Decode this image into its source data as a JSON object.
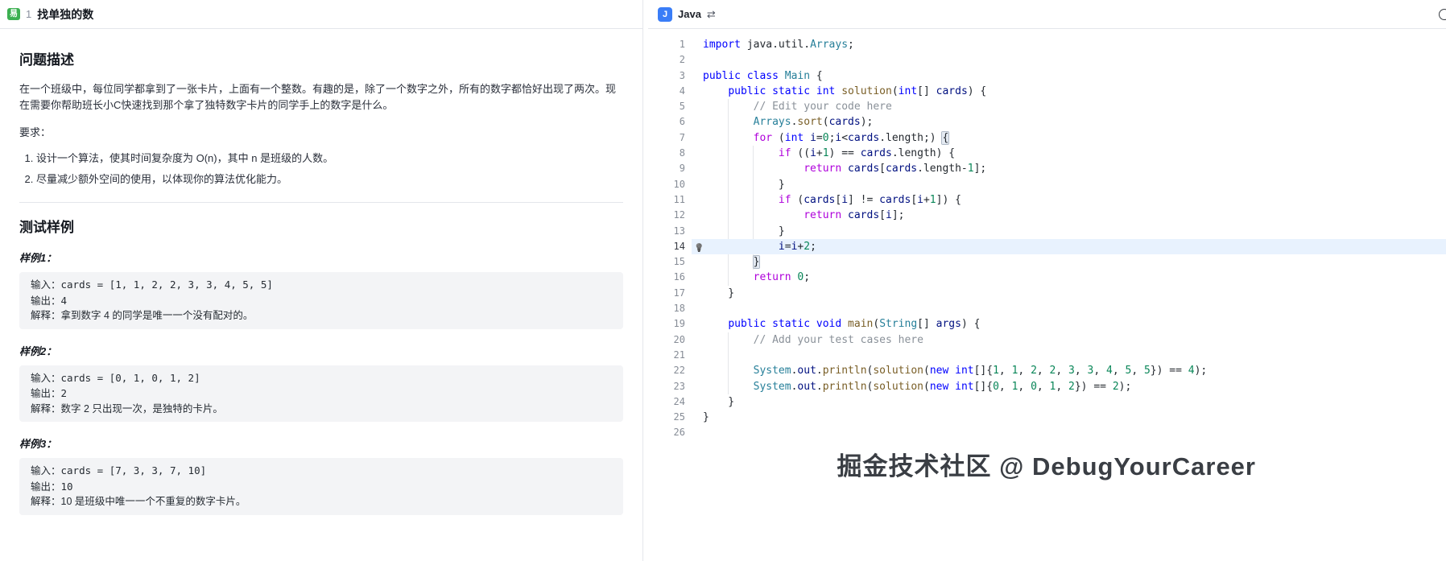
{
  "left_panel": {
    "header": {
      "difficulty_badge": "易",
      "problem_number": "1",
      "title": "找单独的数"
    },
    "description_section": {
      "heading": "问题描述",
      "body": "在一个班级中，每位同学都拿到了一张卡片，上面有一个整数。有趣的是，除了一个数字之外，所有的数字都恰好出现了两次。现在需要你帮助班长小C快速找到那个拿了独特数字卡片的同学手上的数字是什么。",
      "requirements_label": "要求：",
      "requirements": [
        "设计一个算法，使其时间复杂度为 O(n)，其中 n 是班级的人数。",
        "尽量减少额外空间的使用，以体现你的算法优化能力。"
      ]
    },
    "examples_section": {
      "heading": "测试样例",
      "examples": [
        {
          "label": "样例1：",
          "input": "输入：cards = [1, 1, 2, 2, 3, 3, 4, 5, 5]",
          "output": "输出：4",
          "explain": "解释：拿到数字 4 的同学是唯一一个没有配对的。"
        },
        {
          "label": "样例2：",
          "input": "输入：cards = [0, 1, 0, 1, 2]",
          "output": "输出：2",
          "explain": "解释：数字 2 只出现一次，是独特的卡片。"
        },
        {
          "label": "样例3：",
          "input": "输入：cards = [7, 3, 3, 7, 10]",
          "output": "输出：10",
          "explain": "解释：10 是班级中唯一一个不重复的数字卡片。"
        }
      ]
    }
  },
  "editor_panel": {
    "language_label": "Java",
    "icons": {
      "language_icon": "J",
      "switch_icon": "⇄",
      "lightbulb_icon": "💡"
    },
    "active_line": 14,
    "bracket_highlights": [
      {
        "line": 7,
        "char": "{"
      },
      {
        "line": 15,
        "char": "}"
      }
    ],
    "code_lines": [
      "import java.util.Arrays;",
      "",
      "public class Main {",
      "    public static int solution(int[] cards) {",
      "        // Edit your code here",
      "        Arrays.sort(cards);",
      "        for (int i=0;i<cards.length;) {",
      "            if ((i+1) == cards.length) {",
      "                return cards[cards.length-1];",
      "            }",
      "            if (cards[i] != cards[i+1]) {",
      "                return cards[i];",
      "            }",
      "            i=i+2;",
      "        }",
      "        return 0;",
      "    }",
      "",
      "    public static void main(String[] args) {",
      "        // Add your test cases here",
      "",
      "        System.out.println(solution(new int[]{1, 1, 2, 2, 3, 3, 4, 5, 5}) == 4);",
      "        System.out.println(solution(new int[]{0, 1, 0, 1, 2}) == 2);",
      "    }",
      "}",
      ""
    ],
    "watermark": "掘金技术社区 @ DebugYourCareer"
  },
  "colors": {
    "easy_badge": "#3cb051",
    "language_icon_bg": "#3a7df7",
    "active_line_bg": "#e8f2fe",
    "syntax": {
      "keyword": "#0000ff",
      "control": "#af00db",
      "type": "#267f99",
      "function": "#795e26",
      "variable": "#001080",
      "number": "#098658",
      "comment": "#8a9199"
    }
  }
}
